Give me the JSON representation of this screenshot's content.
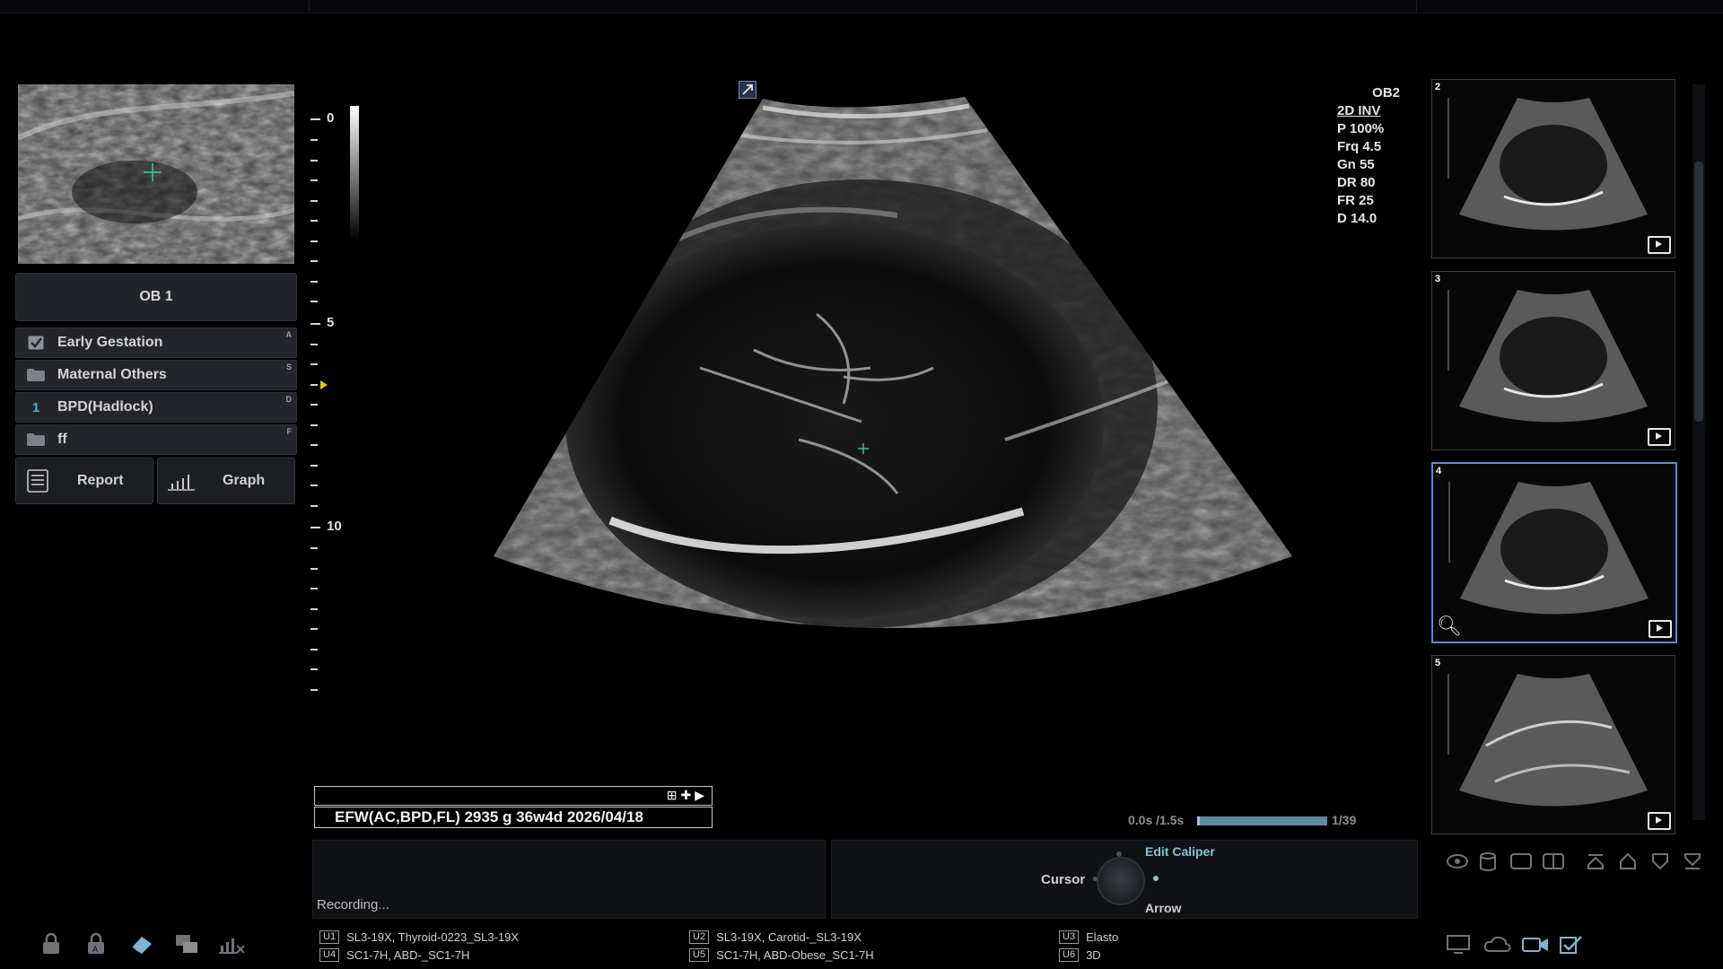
{
  "left_panel": {
    "exam_button": "OB 1",
    "menu": [
      {
        "label": "Early Gestation",
        "icon": "checkbox-icon",
        "hotkey": "A"
      },
      {
        "label": "Maternal Others",
        "icon": "folder-icon",
        "hotkey": "S"
      },
      {
        "label": "BPD(Hadlock)",
        "number": "1",
        "hotkey": "D"
      },
      {
        "label": "ff",
        "icon": "folder-icon",
        "hotkey": "F"
      }
    ],
    "report_label": "Report",
    "graph_label": "Graph"
  },
  "depth_scale": {
    "labels": [
      "0",
      "5",
      "10"
    ]
  },
  "image_params": {
    "mode": "OB2",
    "items": [
      "2D INV",
      "P 100%",
      "Frq 4.5",
      "Gn 55",
      "DR 80",
      "FR 25",
      "D 14.0"
    ]
  },
  "measurement": {
    "text": "EFW(AC,BPD,FL)   2935 g    36w4d  2026/04/18"
  },
  "cine": {
    "time": "0.0s /1.5s",
    "frame": "1/39",
    "progress": 1.0
  },
  "bottom": {
    "recording": "Recording...",
    "cursor_label": "Cursor",
    "edit_caliper": "Edit Caliper",
    "arrow": "Arrow"
  },
  "presets": [
    {
      "key": "U1",
      "label": "SL3-19X, Thyroid-0223_SL3-19X"
    },
    {
      "key": "U4",
      "label": "SC1-7H, ABD-_SC1-7H"
    },
    {
      "key": "U2",
      "label": "SL3-19X, Carotid-_SL3-19X"
    },
    {
      "key": "U5",
      "label": "SC1-7H, ABD-Obese_SC1-7H"
    },
    {
      "key": "U3",
      "label": "Elasto"
    },
    {
      "key": "U6",
      "label": "3D"
    }
  ],
  "thumbnails": [
    {
      "number": "2",
      "active": false
    },
    {
      "number": "3",
      "active": false
    },
    {
      "number": "4",
      "active": true
    },
    {
      "number": "5",
      "active": false
    }
  ]
}
